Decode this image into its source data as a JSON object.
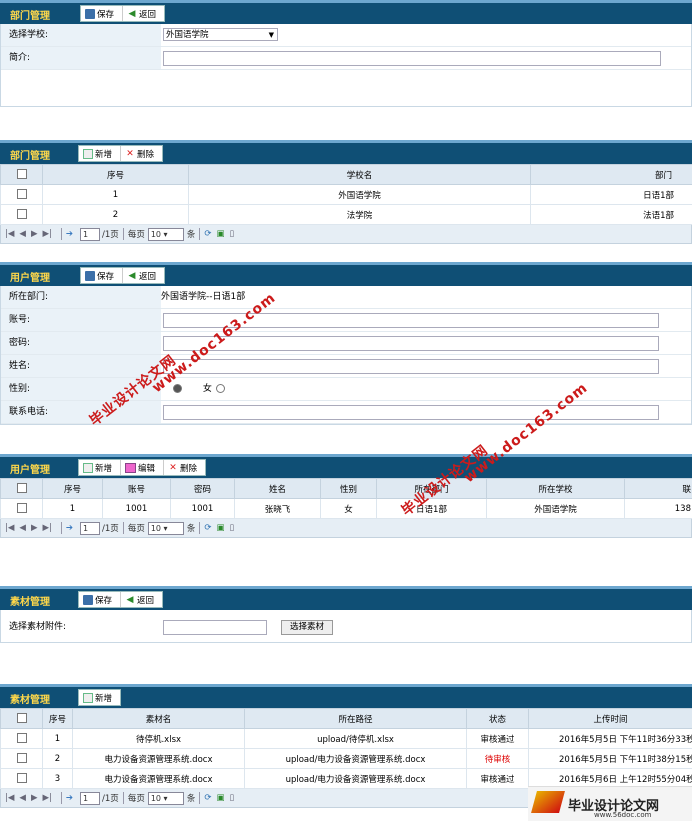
{
  "dept_form": {
    "title": "部门管理",
    "buttons": {
      "save": "保存",
      "back": "返回"
    },
    "school_label": "选择学校:",
    "school_value": "外国语学院",
    "intro_label": "简介:"
  },
  "dept_list": {
    "title": "部门管理",
    "buttons": {
      "add": "新增",
      "delete": "删除"
    },
    "columns": [
      "序号",
      "学校名",
      "部门"
    ],
    "rows": [
      {
        "no": "1",
        "school": "外国语学院",
        "dept": "日语1部"
      },
      {
        "no": "2",
        "school": "法学院",
        "dept": "法语1部"
      }
    ],
    "pager": {
      "page": "1",
      "total_pages": "/1页",
      "per_page_label": "每页",
      "per_page": "10",
      "unit": "条"
    }
  },
  "user_form": {
    "title": "用户管理",
    "buttons": {
      "save": "保存",
      "back": "返回"
    },
    "dept_label": "所在部门:",
    "dept_value": "外国语学院--日语1部",
    "account_label": "账号:",
    "password_label": "密码:",
    "name_label": "姓名:",
    "gender_label": "性别:",
    "gender_female": "女",
    "phone_label": "联系电话:"
  },
  "user_list": {
    "title": "用户管理",
    "buttons": {
      "add": "新增",
      "edit": "编辑",
      "delete": "删除"
    },
    "columns": [
      "序号",
      "账号",
      "密码",
      "姓名",
      "性别",
      "所在部门",
      "所在学校",
      "联"
    ],
    "rows": [
      {
        "no": "1",
        "account": "1001",
        "password": "1001",
        "name": "张晓飞",
        "gender": "女",
        "dept": "日语1部",
        "school": "外国语学院",
        "phone": "138"
      }
    ],
    "pager": {
      "page": "1",
      "total_pages": "/1页",
      "per_page_label": "每页",
      "per_page": "10",
      "unit": "条"
    }
  },
  "material_form": {
    "title": "素材管理",
    "buttons": {
      "save": "保存",
      "back": "返回"
    },
    "file_label": "选择素材附件:",
    "choose_button": "选择素材"
  },
  "material_list": {
    "title": "素材管理",
    "buttons": {
      "add": "新增"
    },
    "columns": [
      "序号",
      "素材名",
      "所在路径",
      "状态",
      "上传时间"
    ],
    "rows": [
      {
        "no": "1",
        "name": "待停机.xlsx",
        "path": "upload/待停机.xlsx",
        "status": "审核通过",
        "time": "2016年5月5日 下午11时36分33秒"
      },
      {
        "no": "2",
        "name": "电力设备资源管理系统.docx",
        "path": "upload/电力设备资源管理系统.docx",
        "status": "待审核",
        "time": "2016年5月5日 下午11时38分15秒"
      },
      {
        "no": "3",
        "name": "电力设备资源管理系统.docx",
        "path": "upload/电力设备资源管理系统.docx",
        "status": "审核通过",
        "time": "2016年5月6日 上午12时55分04秒"
      }
    ],
    "pager": {
      "page": "1",
      "total_pages": "/1页",
      "per_page_label": "每页",
      "per_page": "10",
      "unit": "条"
    }
  },
  "watermarks": {
    "w1": "毕业设计论文网",
    "w2": "www.doc163.com",
    "w3": "毕业设计论文网",
    "w4": "www.doc163.com"
  },
  "logo": {
    "text": "毕业设计论文网",
    "url": "www.56doc.com"
  },
  "colors": {
    "header": "#0f4f75",
    "title": "#ffd84a",
    "pending": "#dd0000"
  }
}
